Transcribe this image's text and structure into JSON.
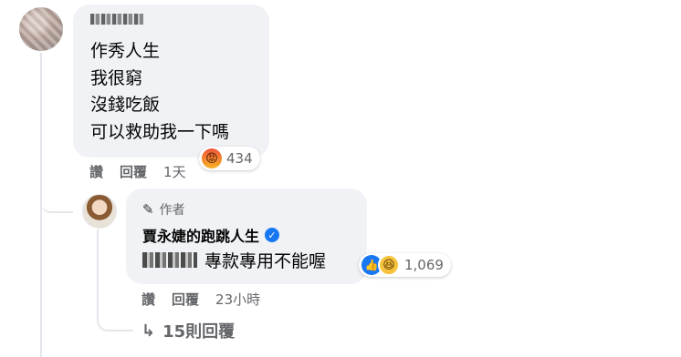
{
  "comment": {
    "lines": [
      "作秀人生",
      "我很窮",
      "沒錢吃飯",
      "可以救助我一下嗎"
    ],
    "reaction_count": "434",
    "reaction_icon": "angry-emoji-icon",
    "actions": {
      "like": "讚",
      "reply": "回覆",
      "time": "1天"
    }
  },
  "reply": {
    "badge": "作者",
    "author": "賈永婕的跑跳人生",
    "text": "專款專用不能喔",
    "reaction_count": "1,069",
    "reaction_icons": [
      "like-icon",
      "haha-emoji-icon"
    ],
    "actions": {
      "like": "讚",
      "reply": "回覆",
      "time": "23小時"
    }
  },
  "more_replies": "15則回覆",
  "colors": {
    "bubble": "#f0f2f5",
    "muted_text": "#65676b",
    "verified": "#1877f2"
  }
}
